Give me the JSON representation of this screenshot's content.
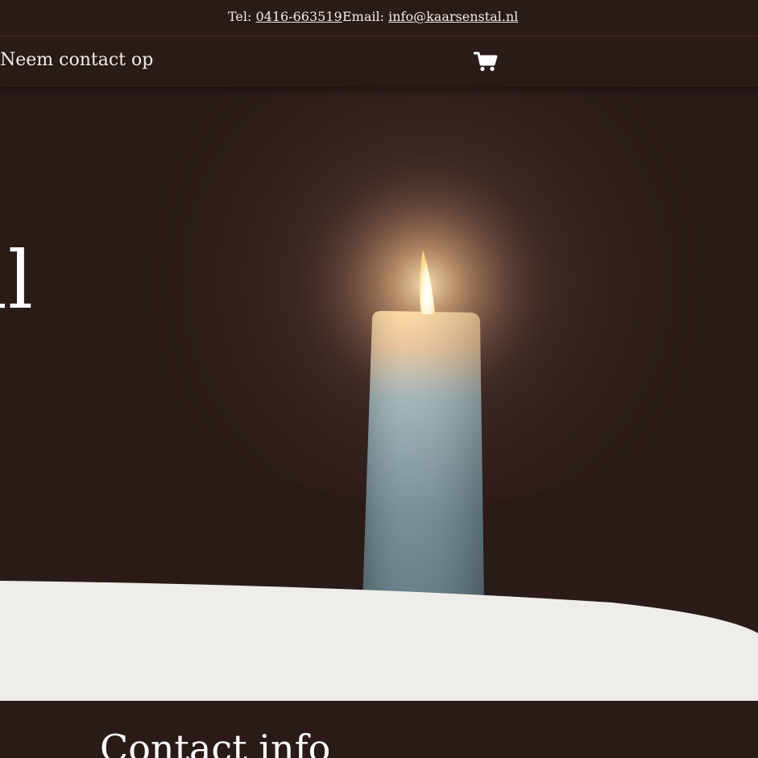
{
  "topbar": {
    "tel_label": "Tel:",
    "tel_value": "0416-663519",
    "email_label": "Email:",
    "email_value": "info@kaarsenstal.nl"
  },
  "nav": {
    "contact_label": "Neem contact op",
    "cart_icon": "shopping-cart-icon"
  },
  "hero": {
    "title_visible": "tal",
    "image": "lit-candle"
  },
  "footer": {
    "heading": "Contact info"
  },
  "colors": {
    "background": "#2a1a18",
    "text": "#f4eee8",
    "light_section": "#eeedea"
  }
}
